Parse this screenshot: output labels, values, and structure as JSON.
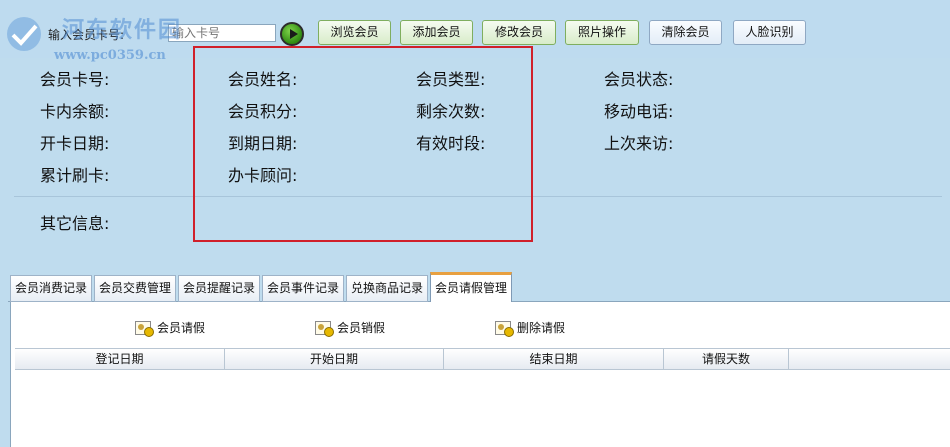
{
  "watermark": {
    "title": "河东软件园",
    "url": "www.pc0359.cn"
  },
  "toolbar": {
    "card_label": "输入会员卡号:",
    "card_placeholder": "输入卡号",
    "buttons": [
      "浏览会员",
      "添加会员",
      "修改会员",
      "照片操作",
      "清除会员",
      "人脸识别"
    ]
  },
  "info": {
    "fields": [
      "会员卡号:",
      "会员姓名:",
      "会员类型:",
      "会员状态:",
      "卡内余额:",
      "会员积分:",
      "剩余次数:",
      "移动电话:",
      "开卡日期:",
      "到期日期:",
      "有效时段:",
      "上次来访:",
      "累计刷卡:",
      "办卡顾问:"
    ],
    "other": "其它信息:"
  },
  "tabs": {
    "items": [
      "会员消费记录",
      "会员交费管理",
      "会员提醒记录",
      "会员事件记录",
      "兑换商品记录",
      "会员请假管理"
    ],
    "active": 5
  },
  "actions": [
    "会员请假",
    "会员销假",
    "删除请假"
  ],
  "grid": {
    "columns": [
      "登记日期",
      "开始日期",
      "结束日期",
      "请假天数"
    ]
  },
  "colors": {
    "background": "#bfdcee",
    "highlight_box": "#d0202a",
    "active_tab_accent": "#e8a040"
  }
}
